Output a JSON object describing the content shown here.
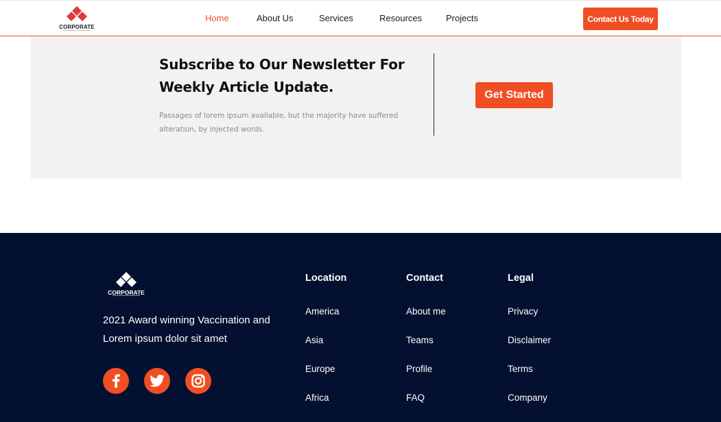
{
  "header": {
    "logo_text": "CORPORATE",
    "nav": [
      {
        "label": "Home",
        "active": true
      },
      {
        "label": "About Us",
        "active": false
      },
      {
        "label": "Services",
        "active": false
      },
      {
        "label": "Resources",
        "active": false
      },
      {
        "label": "Projects",
        "active": false
      }
    ],
    "cta_label": "Contact Us Today"
  },
  "newsletter": {
    "title_line1": "Subscribe to Our Newsletter For",
    "title_line2": "Weekly Article Update.",
    "description": "Passages of lorem ipsum available, but the majority have suffered alteration, by injected words.",
    "button_label": "Get Started"
  },
  "footer": {
    "logo_text": "CORPORATE",
    "tagline": "2021 Award winning Vaccination and Lorem ipsum dolor sit amet",
    "social": [
      {
        "icon": "facebook-icon"
      },
      {
        "icon": "twitter-icon"
      },
      {
        "icon": "instagram-icon"
      }
    ],
    "columns": [
      {
        "title": "Location",
        "links": [
          "America",
          "Asia",
          "Europe",
          "Africa"
        ]
      },
      {
        "title": "Contact",
        "links": [
          "About me",
          "Teams",
          "Profile",
          "FAQ"
        ]
      },
      {
        "title": "Legal",
        "links": [
          "Privacy",
          "Disclaimer",
          "Terms",
          "Company"
        ]
      }
    ]
  },
  "colors": {
    "accent": "#f04e23",
    "footer_bg": "#04102f",
    "newsletter_bg": "#f2f2f2"
  }
}
